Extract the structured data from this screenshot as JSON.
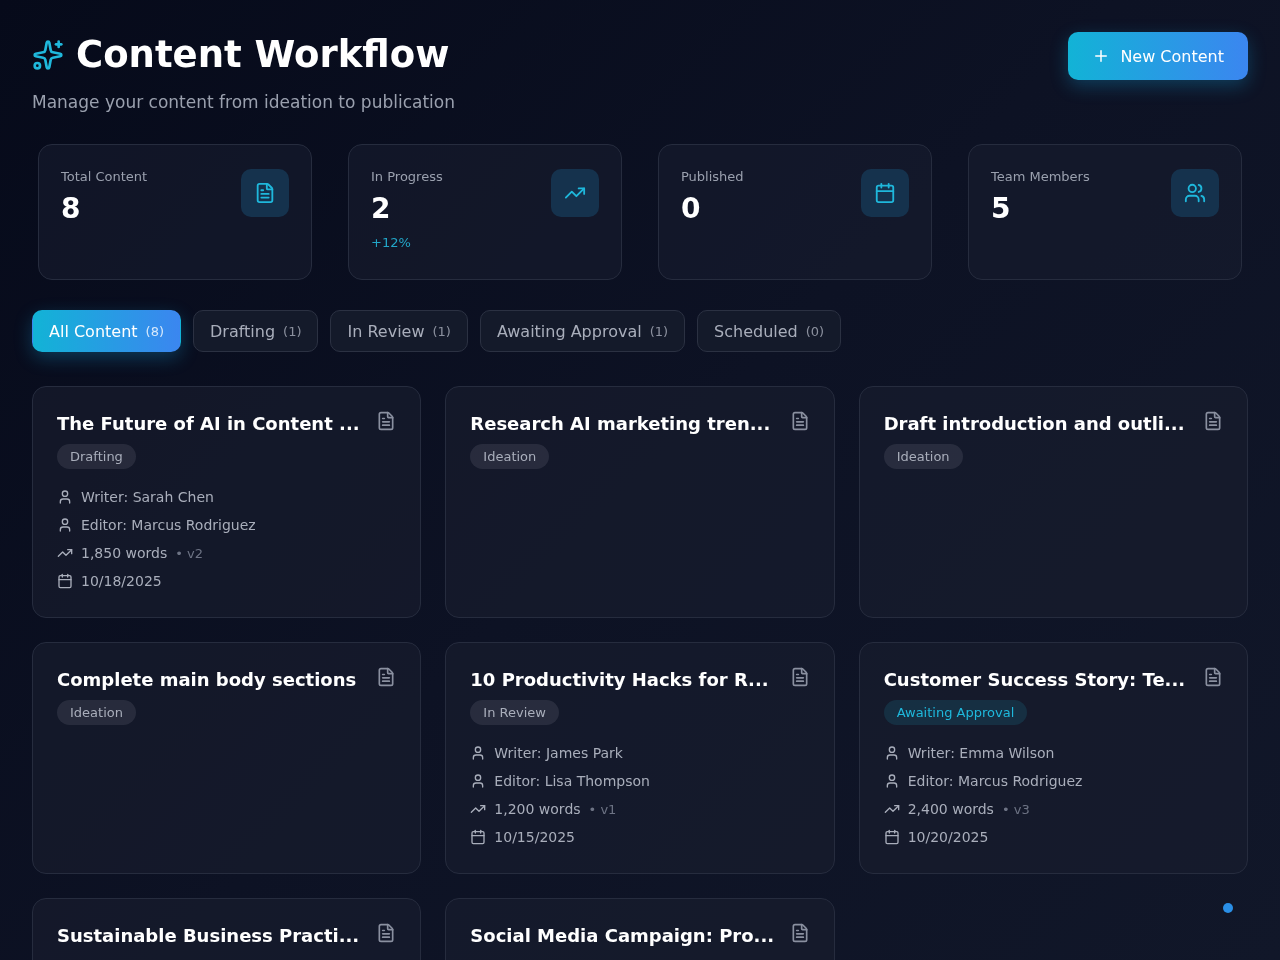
{
  "header": {
    "title": "Content Workflow",
    "subtitle": "Manage your content from ideation to publication",
    "new_button": "New Content"
  },
  "stats": [
    {
      "kind": "document",
      "label": "Total Content",
      "value": "8"
    },
    {
      "kind": "trend",
      "label": "In Progress",
      "value": "2",
      "change": "+12%"
    },
    {
      "kind": "calendar",
      "label": "Published",
      "value": "0"
    },
    {
      "kind": "team",
      "label": "Team Members",
      "value": "5"
    }
  ],
  "tabs": [
    {
      "label": "All Content",
      "count": "(8)",
      "selected": true
    },
    {
      "label": "Drafting",
      "count": "(1)",
      "selected": false
    },
    {
      "label": "In Review",
      "count": "(1)",
      "selected": false
    },
    {
      "label": "Awaiting Approval",
      "count": "(1)",
      "selected": false
    },
    {
      "label": "Scheduled",
      "count": "(0)",
      "selected": false
    }
  ],
  "cards": [
    {
      "title": "The Future of AI in Content ...",
      "status": {
        "label": "Drafting",
        "color": "#a9aebb"
      },
      "writer": "Writer: Sarah Chen",
      "editor": "Editor: Marcus Rodriguez",
      "words": "1,850 words",
      "version": "• v2",
      "date": "10/18/2025"
    },
    {
      "title": "Research AI marketing tren...",
      "status": {
        "label": "Ideation",
        "color": "#a9aebb"
      }
    },
    {
      "title": "Draft introduction and outli...",
      "status": {
        "label": "Ideation",
        "color": "#a9aebb"
      }
    },
    {
      "title": "Complete main body sections",
      "status": {
        "label": "Ideation",
        "color": "#a9aebb"
      }
    },
    {
      "title": "10 Productivity Hacks for R...",
      "status": {
        "label": "In Review",
        "color": "#a9aebb"
      },
      "writer": "Writer: James Park",
      "editor": "Editor: Lisa Thompson",
      "words": "1,200 words",
      "version": "• v1",
      "date": "10/15/2025"
    },
    {
      "title": "Customer Success Story: Te...",
      "status": {
        "label": "Awaiting Approval",
        "color": "#1fb8dc"
      },
      "writer": "Writer: Emma Wilson",
      "editor": "Editor: Marcus Rodriguez",
      "words": "2,400 words",
      "version": "• v3",
      "date": "10/20/2025"
    },
    {
      "title": "Sustainable Business Practi..."
    },
    {
      "title": "Social Media Campaign: Pro..."
    }
  ]
}
